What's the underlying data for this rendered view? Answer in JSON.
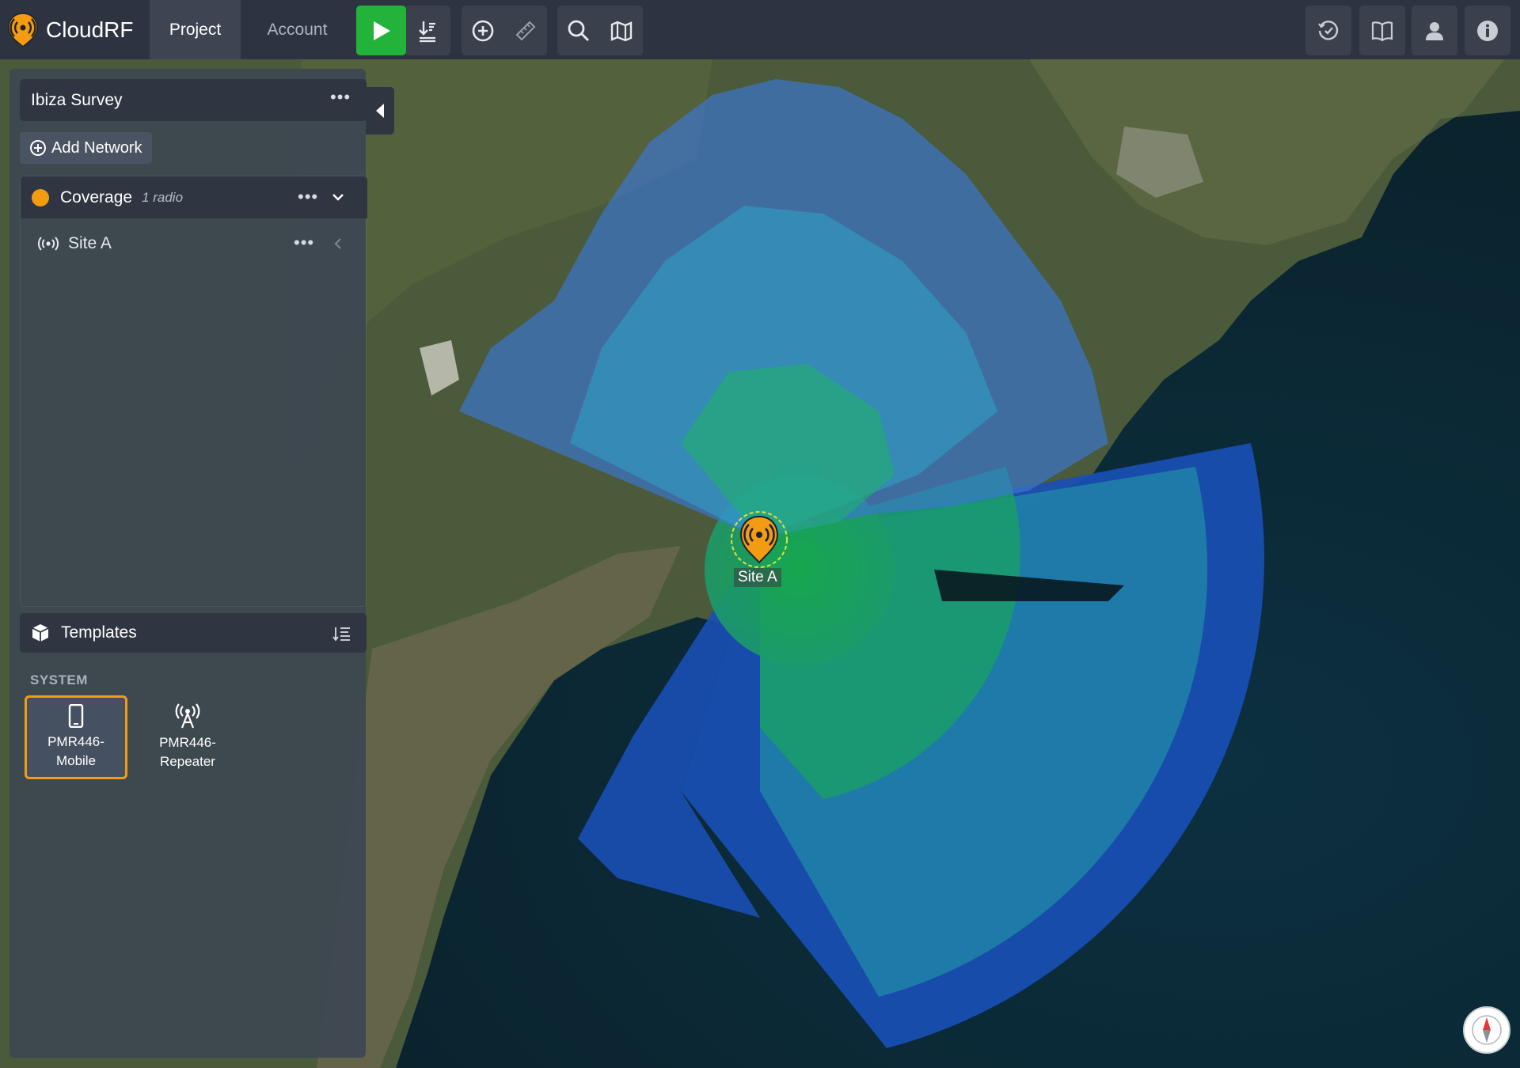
{
  "app": {
    "name": "CloudRF",
    "tabs": [
      {
        "label": "Project",
        "active": true
      },
      {
        "label": "Account",
        "active": false
      }
    ],
    "brand_color": "#f39c12",
    "run_color": "#23b23a"
  },
  "toolbar": {
    "run_icon": "play-icon",
    "left_icons": [
      "play-icon",
      "download-coverage-icon",
      "add-site-icon",
      "ruler-icon",
      "search-icon",
      "map-layers-icon"
    ],
    "right_icons": [
      "history-icon",
      "docs-book-icon",
      "user-icon",
      "info-icon"
    ]
  },
  "sidebar": {
    "project_name": "Ibiza Survey",
    "add_network_label": "Add Network",
    "network": {
      "name": "Coverage",
      "count": "1 radio",
      "dot_color": "#f39c12"
    },
    "sites": [
      {
        "name": "Site A"
      }
    ],
    "templates_title": "Templates",
    "system_label": "SYSTEM",
    "templates": [
      {
        "line1": "PMR446-",
        "line2": "Mobile",
        "icon": "mobile-phone-icon",
        "selected": true
      },
      {
        "line1": "PMR446-",
        "line2": "Repeater",
        "icon": "antenna-tower-icon",
        "selected": false
      }
    ]
  },
  "map": {
    "marker_label": "Site A",
    "coverage_colors": [
      "#1a4fb5",
      "#1f7fa8",
      "#1a9e6a",
      "#1fb33a"
    ]
  }
}
